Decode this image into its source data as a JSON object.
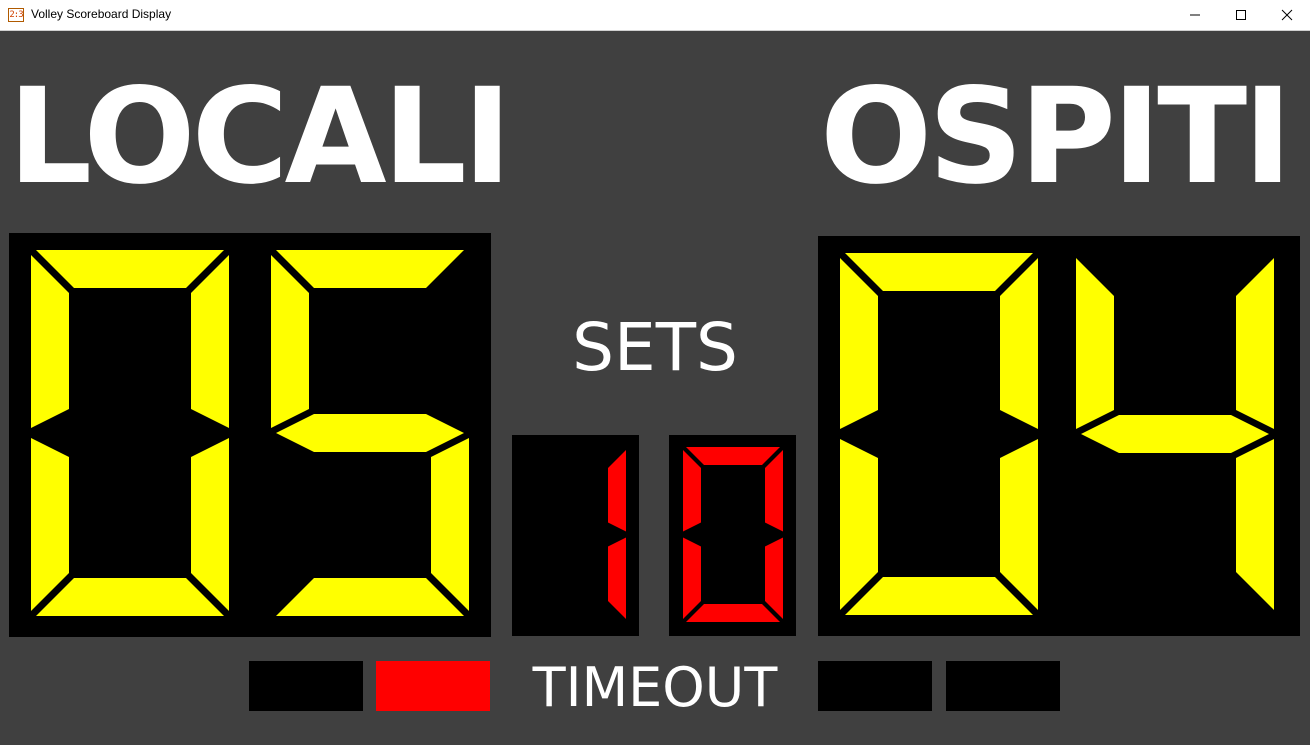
{
  "window": {
    "title": "Volley Scoreboard Display",
    "icon_text": "2:3",
    "icon_name": "scoreboard-app-icon"
  },
  "home": {
    "name": "LOCALI",
    "score": "05",
    "sets": "1",
    "timeouts": [
      false,
      true
    ]
  },
  "away": {
    "name": "OSPITI",
    "score": "04",
    "sets": "0",
    "timeouts": [
      false,
      false
    ]
  },
  "labels": {
    "sets": "SETS",
    "timeout": "TIMEOUT"
  },
  "colors": {
    "background": "#404040",
    "score_digit": "#ffff00",
    "set_digit": "#ff0000",
    "timeout_on": "#ff0000",
    "timeout_off": "#000000",
    "team_name": "#ffffff"
  }
}
